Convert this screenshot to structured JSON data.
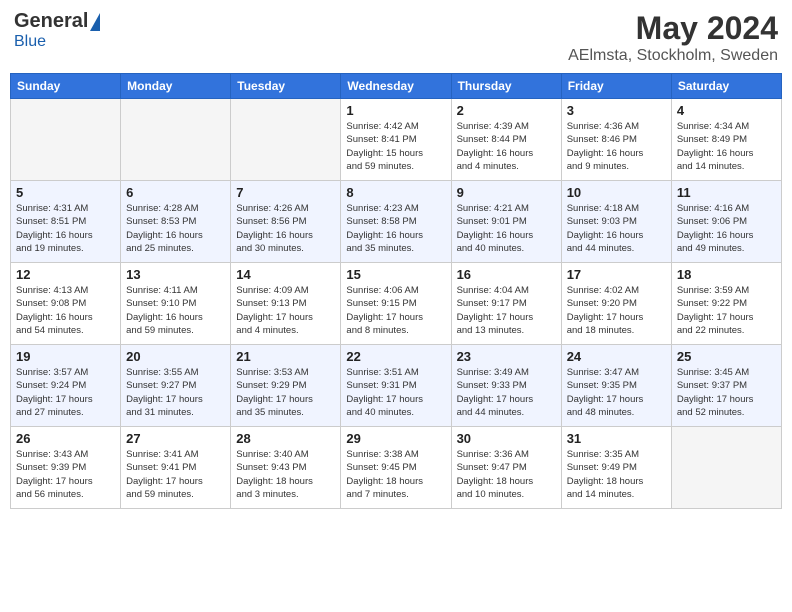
{
  "header": {
    "logo_general": "General",
    "logo_blue": "Blue",
    "month_year": "May 2024",
    "location": "AElmsta, Stockholm, Sweden"
  },
  "days_of_week": [
    "Sunday",
    "Monday",
    "Tuesday",
    "Wednesday",
    "Thursday",
    "Friday",
    "Saturday"
  ],
  "weeks": [
    [
      {
        "day": "",
        "info": ""
      },
      {
        "day": "",
        "info": ""
      },
      {
        "day": "",
        "info": ""
      },
      {
        "day": "1",
        "info": "Sunrise: 4:42 AM\nSunset: 8:41 PM\nDaylight: 15 hours\nand 59 minutes."
      },
      {
        "day": "2",
        "info": "Sunrise: 4:39 AM\nSunset: 8:44 PM\nDaylight: 16 hours\nand 4 minutes."
      },
      {
        "day": "3",
        "info": "Sunrise: 4:36 AM\nSunset: 8:46 PM\nDaylight: 16 hours\nand 9 minutes."
      },
      {
        "day": "4",
        "info": "Sunrise: 4:34 AM\nSunset: 8:49 PM\nDaylight: 16 hours\nand 14 minutes."
      }
    ],
    [
      {
        "day": "5",
        "info": "Sunrise: 4:31 AM\nSunset: 8:51 PM\nDaylight: 16 hours\nand 19 minutes."
      },
      {
        "day": "6",
        "info": "Sunrise: 4:28 AM\nSunset: 8:53 PM\nDaylight: 16 hours\nand 25 minutes."
      },
      {
        "day": "7",
        "info": "Sunrise: 4:26 AM\nSunset: 8:56 PM\nDaylight: 16 hours\nand 30 minutes."
      },
      {
        "day": "8",
        "info": "Sunrise: 4:23 AM\nSunset: 8:58 PM\nDaylight: 16 hours\nand 35 minutes."
      },
      {
        "day": "9",
        "info": "Sunrise: 4:21 AM\nSunset: 9:01 PM\nDaylight: 16 hours\nand 40 minutes."
      },
      {
        "day": "10",
        "info": "Sunrise: 4:18 AM\nSunset: 9:03 PM\nDaylight: 16 hours\nand 44 minutes."
      },
      {
        "day": "11",
        "info": "Sunrise: 4:16 AM\nSunset: 9:06 PM\nDaylight: 16 hours\nand 49 minutes."
      }
    ],
    [
      {
        "day": "12",
        "info": "Sunrise: 4:13 AM\nSunset: 9:08 PM\nDaylight: 16 hours\nand 54 minutes."
      },
      {
        "day": "13",
        "info": "Sunrise: 4:11 AM\nSunset: 9:10 PM\nDaylight: 16 hours\nand 59 minutes."
      },
      {
        "day": "14",
        "info": "Sunrise: 4:09 AM\nSunset: 9:13 PM\nDaylight: 17 hours\nand 4 minutes."
      },
      {
        "day": "15",
        "info": "Sunrise: 4:06 AM\nSunset: 9:15 PM\nDaylight: 17 hours\nand 8 minutes."
      },
      {
        "day": "16",
        "info": "Sunrise: 4:04 AM\nSunset: 9:17 PM\nDaylight: 17 hours\nand 13 minutes."
      },
      {
        "day": "17",
        "info": "Sunrise: 4:02 AM\nSunset: 9:20 PM\nDaylight: 17 hours\nand 18 minutes."
      },
      {
        "day": "18",
        "info": "Sunrise: 3:59 AM\nSunset: 9:22 PM\nDaylight: 17 hours\nand 22 minutes."
      }
    ],
    [
      {
        "day": "19",
        "info": "Sunrise: 3:57 AM\nSunset: 9:24 PM\nDaylight: 17 hours\nand 27 minutes."
      },
      {
        "day": "20",
        "info": "Sunrise: 3:55 AM\nSunset: 9:27 PM\nDaylight: 17 hours\nand 31 minutes."
      },
      {
        "day": "21",
        "info": "Sunrise: 3:53 AM\nSunset: 9:29 PM\nDaylight: 17 hours\nand 35 minutes."
      },
      {
        "day": "22",
        "info": "Sunrise: 3:51 AM\nSunset: 9:31 PM\nDaylight: 17 hours\nand 40 minutes."
      },
      {
        "day": "23",
        "info": "Sunrise: 3:49 AM\nSunset: 9:33 PM\nDaylight: 17 hours\nand 44 minutes."
      },
      {
        "day": "24",
        "info": "Sunrise: 3:47 AM\nSunset: 9:35 PM\nDaylight: 17 hours\nand 48 minutes."
      },
      {
        "day": "25",
        "info": "Sunrise: 3:45 AM\nSunset: 9:37 PM\nDaylight: 17 hours\nand 52 minutes."
      }
    ],
    [
      {
        "day": "26",
        "info": "Sunrise: 3:43 AM\nSunset: 9:39 PM\nDaylight: 17 hours\nand 56 minutes."
      },
      {
        "day": "27",
        "info": "Sunrise: 3:41 AM\nSunset: 9:41 PM\nDaylight: 17 hours\nand 59 minutes."
      },
      {
        "day": "28",
        "info": "Sunrise: 3:40 AM\nSunset: 9:43 PM\nDaylight: 18 hours\nand 3 minutes."
      },
      {
        "day": "29",
        "info": "Sunrise: 3:38 AM\nSunset: 9:45 PM\nDaylight: 18 hours\nand 7 minutes."
      },
      {
        "day": "30",
        "info": "Sunrise: 3:36 AM\nSunset: 9:47 PM\nDaylight: 18 hours\nand 10 minutes."
      },
      {
        "day": "31",
        "info": "Sunrise: 3:35 AM\nSunset: 9:49 PM\nDaylight: 18 hours\nand 14 minutes."
      },
      {
        "day": "",
        "info": ""
      }
    ]
  ]
}
